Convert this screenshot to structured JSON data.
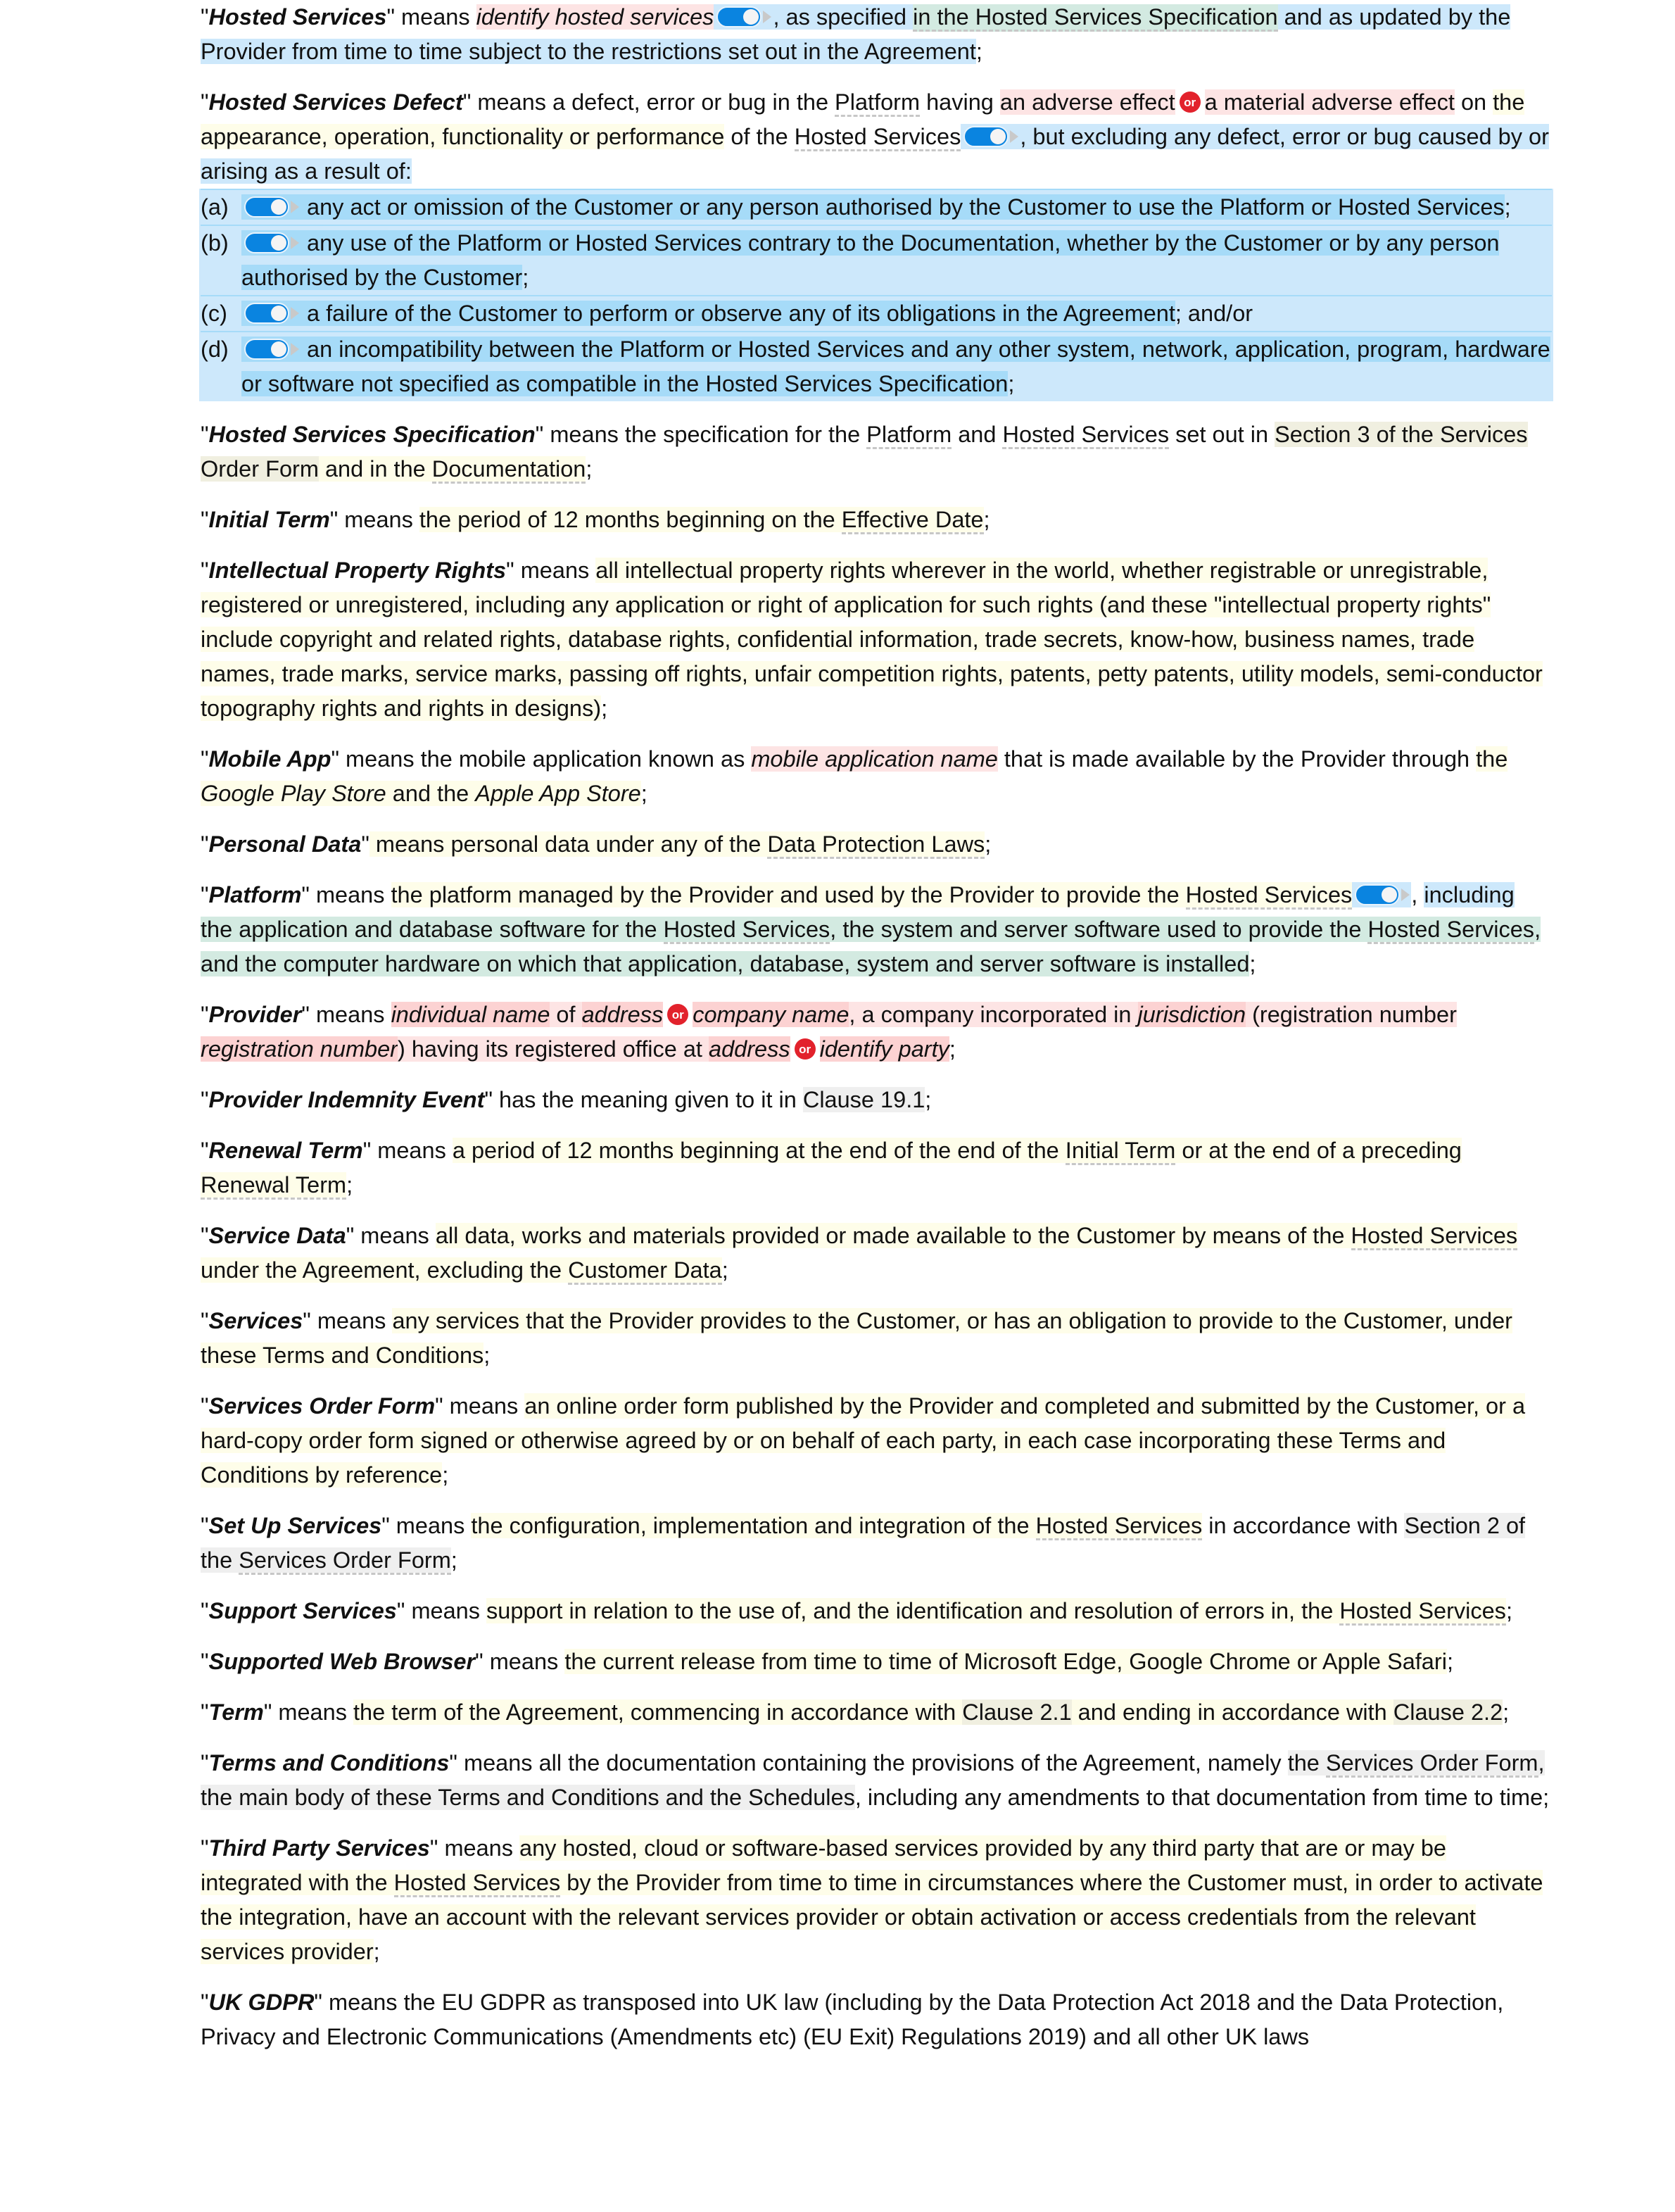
{
  "colors": {
    "toggle_on": "#0a84e0",
    "or_badge": "#e2222c",
    "highlight_optional": "#cde8fb",
    "highlight_placeholder": "#fcd2d2",
    "highlight_variable": "#fefde9",
    "highlight_linked": "#d3eae1",
    "highlight_reference": "#efefef"
  },
  "icons": {
    "toggle": "toggle-switch-icon",
    "or": "or-badge-icon",
    "expand": "triangle-right-icon"
  },
  "or_label": "or",
  "defs": {
    "hosted_services": {
      "term": "Hosted Services",
      "p1": " means ",
      "placeholder": "identify hosted services",
      "p2": ", as specified ",
      "spec": "in the Hosted Services Specification",
      "p3": " and as updated by the Provider from time to time subject to the restrictions set out in the Agreement",
      "end": ";"
    },
    "hosted_services_defect": {
      "term": "Hosted Services Defect",
      "p1": " means a defect, error or bug in the ",
      "platform": "Platform",
      "p2": " having ",
      "opt1": "an adverse effect",
      "opt2": "a material adverse effect",
      "p3": " on ",
      "v1": "the appearance, operation, functionality or performance",
      "p4": " of the ",
      "hs": "Hosted Services",
      "p5": ", but excluding any defect, error or bug caused by or arising as a result of:",
      "items": [
        {
          "label": "(a)",
          "text": "any act or omission of the Customer or any person authorised by the Customer to use the Platform or Hosted Services",
          "end": ";"
        },
        {
          "label": "(b)",
          "text": "any use of the Platform or Hosted Services contrary to the Documentation, whether by the Customer or by any person authorised by the Customer",
          "end": ";"
        },
        {
          "label": "(c)",
          "text": "a failure of the Customer to perform or observe any of its obligations in the Agreement",
          "end": "; and/or"
        },
        {
          "label": "(d)",
          "text": "an incompatibility between the Platform or Hosted Services and any other system, network, application, program, hardware or software not specified as compatible in the Hosted Services Specification",
          "end": ";"
        }
      ]
    },
    "hosted_services_specification": {
      "term": "Hosted Services Specification",
      "p1": " means the specification for the ",
      "platform": "Platform",
      "and": " and ",
      "hs": "Hosted Services",
      "p2": " set out in ",
      "section": "Section 3 of the Services Order Form",
      "p3": " and in the ",
      "doc": "Documentation",
      "end": ";"
    },
    "initial_term": {
      "term": "Initial Term",
      "p1": " means ",
      "v": "the period of 12 months beginning on the ",
      "ref": "Effective Date",
      "end": ";"
    },
    "ipr": {
      "term": "Intellectual Property Rights",
      "p1": " means ",
      "v": "all intellectual property rights wherever in the world, whether registrable or unregistrable, registered or unregistered, including any application or right of application for such rights (and these \"intellectual property rights\" include copyright and related rights, database rights, confidential information, trade secrets, know-how, business names, trade names, trade marks, service marks, passing off rights, unfair competition rights, patents, petty patents, utility models, semi-conductor topography rights and rights in designs)",
      "end": ";"
    },
    "mobile_app": {
      "term": "Mobile App",
      "p1": " means the mobile application known as ",
      "placeholder": "mobile application name",
      "p2": " that is made available by the Provider through ",
      "v1": "the ",
      "store1": "Google Play Store",
      "v2": " and the ",
      "store2": "Apple App Store",
      "end": ";"
    },
    "personal_data": {
      "term": "Personal Data",
      "p1": " means ",
      "v": "personal data under any of the ",
      "ref": "Data Protection Laws",
      "end": ";"
    },
    "platform": {
      "term": "Platform",
      "p1": " means ",
      "v": "the platform managed by the Provider and used by the Provider to provide the ",
      "hs": "Hosted Services",
      "comma": ",",
      "opt": "including",
      "linked1": " the application and database software for the ",
      "hs2": "Hosted Services",
      "linked2": ", the system and server software used to provide the ",
      "hs3": "Hosted Services",
      "linked3": ", and the computer hardware on which that application, database, system and server software is installed",
      "end": ";"
    },
    "provider": {
      "term": "Provider",
      "p1": " means ",
      "ph1": "individual name",
      "of": " of ",
      "ph2": "address",
      "ph3": "company name",
      "p2": ", a company incorporated in ",
      "ph4": "jurisdiction",
      "p3": " (registration number ",
      "ph5": "registration number",
      "p4": ") having its registered office at ",
      "ph6": "address",
      "ph7": "identify party",
      "end": ";"
    },
    "provider_indemnity_event": {
      "term": "Provider Indemnity Event",
      "p1": " has the meaning given to it in ",
      "ref": "Clause 19.1",
      "end": ";"
    },
    "renewal_term": {
      "term": "Renewal Term",
      "p1": " means ",
      "v1": "a period of 12 months beginning at the end of the end of the ",
      "ref1": "Initial Term",
      "v2": " or at the end of a preceding ",
      "ref2": "Renewal Term",
      "end": ";"
    },
    "service_data": {
      "term": "Service Data",
      "p1": " means ",
      "v1": "all data, works and materials provided or made available to the Customer by means of the ",
      "ref1": "Hosted Services",
      "v2": " under the Agreement, excluding the ",
      "ref2": "Customer Data",
      "end": ";"
    },
    "services": {
      "term": "Services",
      "p1": " means ",
      "v": "any services that the Provider provides to the Customer, or has an obligation to provide to the Customer, under these Terms and Conditions",
      "end": ";"
    },
    "services_order_form": {
      "term": "Services Order Form",
      "p1": " means ",
      "v": "an online order form published by the Provider and completed and submitted by the Customer, or a hard-copy order form signed or otherwise agreed by or on behalf of each party, in each case incorporating these Terms and Conditions by reference",
      "end": ";"
    },
    "set_up_services": {
      "term": "Set Up Services",
      "p1": " means ",
      "v1": "the configuration, implementation and integration of the ",
      "ref1": "Hosted Services",
      "p2": " in accordance with ",
      "sec1": "Section 2 of the ",
      "ref2": "Services Order Form",
      "end": ";"
    },
    "support_services": {
      "term": "Support Services",
      "p1": " means ",
      "v": "support in relation to the use of, and the identification and resolution of errors in, the ",
      "ref": "Hosted Services",
      "end": ";"
    },
    "supported_web_browser": {
      "term": "Supported Web Browser",
      "p1": " means ",
      "v": "the current release from time to time of Microsoft Edge, Google Chrome or Apple Safari",
      "end": ";"
    },
    "term": {
      "term": "Term",
      "p1": " means ",
      "v1": "the term of the Agreement, commencing in accordance with ",
      "ref1": "Clause 2.1",
      "v2": " and ending in accordance with ",
      "ref2": "Clause 2.2",
      "end": ";"
    },
    "terms_and_conditions": {
      "term": "Terms and Conditions",
      "p1": " means all the documentation containing the provisions of the Agreement, namely ",
      "g1": "the ",
      "ref1": "Services Order Form",
      "g2": ", the main body of these Terms and Conditions and the Schedules",
      "p2": ", including any amendments to that documentation from time to time;"
    },
    "third_party_services": {
      "term": "Third Party Services",
      "p1": " means ",
      "v1": "any hosted, cloud or software-based services provided by any third party that are or may be integrated with the ",
      "ref": "Hosted Services",
      "v2": " by the Provider from time to time in circumstances where the Customer must, in order to activate the integration, have an account with the relevant services provider or obtain activation or access credentials from the relevant services provider",
      "end": ";"
    },
    "uk_gdpr": {
      "term": "UK GDPR",
      "p1": " means the EU GDPR as transposed into UK law (including by the Data Protection Act 2018 and the Data Protection, Privacy and Electronic Communications (Amendments etc) (EU Exit) Regulations 2019) and all other UK laws"
    }
  }
}
